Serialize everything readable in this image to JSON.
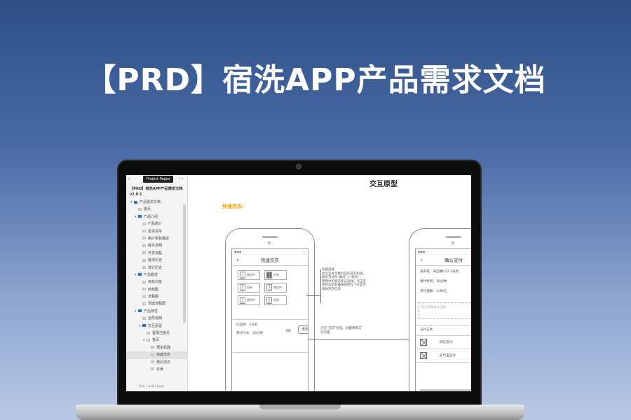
{
  "banner": {
    "title": "【PRD】宿洗APP产品需求文档"
  },
  "sidebar": {
    "tab_label": "Project Pages",
    "project_title": "【PRD】宿洗APP产品需求文档",
    "version": "v1.0.1",
    "items": [
      {
        "label": "产品需求文档",
        "type": "folder",
        "expanded": true
      },
      {
        "label": "首页",
        "type": "page"
      },
      {
        "label": "产品介绍",
        "type": "folder",
        "expanded": true
      },
      {
        "label": "产品简介",
        "type": "page"
      },
      {
        "label": "需求清单",
        "type": "page"
      },
      {
        "label": "用户角色描述",
        "type": "page"
      },
      {
        "label": "版本说明",
        "type": "page"
      },
      {
        "label": "开发流程",
        "type": "page"
      },
      {
        "label": "版本历史",
        "type": "page"
      },
      {
        "label": "修订历史",
        "type": "page"
      },
      {
        "label": "产品概述",
        "type": "folder",
        "expanded": true
      },
      {
        "label": "目标功能",
        "type": "page"
      },
      {
        "label": "结构图",
        "type": "page"
      },
      {
        "label": "流程图",
        "type": "page"
      },
      {
        "label": "页面流程图",
        "type": "page"
      },
      {
        "label": "产品特性",
        "type": "folder",
        "expanded": true
      },
      {
        "label": "全局说明",
        "type": "page"
      },
      {
        "label": "交互原型",
        "type": "folder",
        "expanded": true
      },
      {
        "label": "登录注册页",
        "type": "page"
      },
      {
        "label": "首页",
        "type": "page",
        "caret": true
      },
      {
        "label": "预定机器",
        "type": "page"
      },
      {
        "label": "快速洗衣",
        "type": "page",
        "selected": true
      },
      {
        "label": "预约洗衣",
        "type": "page"
      },
      {
        "label": "衣食",
        "type": "page"
      }
    ],
    "bottom_hint": "Use [ and ] keys"
  },
  "content": {
    "title": "交互原型",
    "section_label": "快速洗衣:",
    "phone1": {
      "nav_title": "快速洗衣",
      "machines": [
        {
          "num": "1号",
          "status": "使用中",
          "dark": false
        },
        {
          "num": "2号",
          "status": "空闲",
          "dark": true
        },
        {
          "num": "3号",
          "status": "空闲",
          "dark": false
        },
        {
          "num": "4号",
          "status": "使用中",
          "dark": false
        },
        {
          "num": "5号",
          "status": "使用中",
          "dark": false
        },
        {
          "num": "6号",
          "status": "空闲",
          "dark": false
        }
      ],
      "selected_label": "已选择：2号机",
      "duration_label": "预计时长：30分钟",
      "price": "3元",
      "wash_button": "洗衣"
    },
    "note1": [
      "机器选择",
      "显示该食堂楼对应的洗衣机组。",
      "展示方式为“编号”+“状态”，",
      "使用中的状态无法选择。点击空",
      "闲状态的机器按钮则在下方显示",
      "相关洗衣信息"
    ],
    "note2": [
      "点击“洗衣”按钮，则跳转到支",
      "付页面"
    ],
    "phone2": {
      "nav_title": "确认支付",
      "washer_label": "洗衣机：",
      "washer_value": "海淀楼H17-2号机",
      "duration_label": "预计时间：",
      "duration_value": "30分钟",
      "amount_label": "支付金额：",
      "amount_value": "3.00元",
      "remark_placeholder": "在此添加备注信息",
      "pay_method_label": "支付方式",
      "pay_options": [
        "微信支付",
        "支付宝支付"
      ],
      "pay_button": "支付"
    }
  }
}
